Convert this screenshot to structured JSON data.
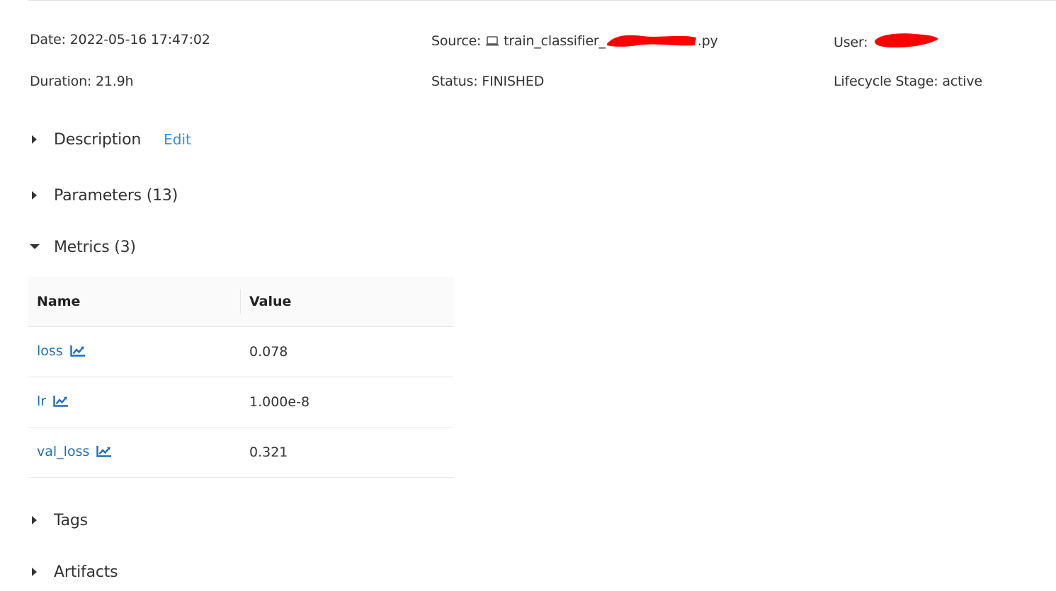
{
  "run": {
    "date_label": "Date:",
    "date_value": "2022-05-16 17:47:02",
    "source_label": "Source:",
    "source_prefix": "train_classifier_",
    "source_suffix": ".py",
    "user_label": "User:",
    "duration_label": "Duration:",
    "duration_value": "21.9h",
    "status_label": "Status:",
    "status_value": "FINISHED",
    "lifecycle_label": "Lifecycle Stage:",
    "lifecycle_value": "active"
  },
  "sections": {
    "description": {
      "title": "Description",
      "edit_label": "Edit",
      "expanded": false
    },
    "parameters": {
      "title": "Parameters (13)",
      "expanded": false
    },
    "metrics": {
      "title": "Metrics (3)",
      "expanded": true
    },
    "tags": {
      "title": "Tags",
      "expanded": false
    },
    "artifacts": {
      "title": "Artifacts",
      "expanded": false
    }
  },
  "metrics_table": {
    "headers": [
      "Name",
      "Value"
    ],
    "rows": [
      {
        "name": "loss",
        "value": "0.078"
      },
      {
        "name": "lr",
        "value": "1.000e-8"
      },
      {
        "name": "val_loss",
        "value": "0.321"
      }
    ]
  },
  "icons": {
    "collapsed": "caret-right-icon",
    "expanded": "caret-down-icon",
    "source": "laptop-icon",
    "metric": "line-chart-icon"
  },
  "colors": {
    "link": "#2d8cf0",
    "metric_link": "#1f6fb2",
    "redaction": "#ff0000",
    "header_bg": "#fafafa"
  }
}
